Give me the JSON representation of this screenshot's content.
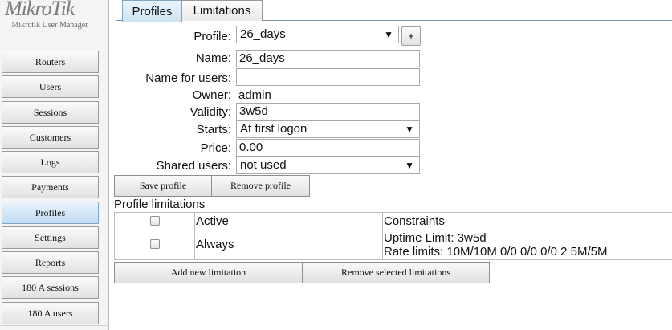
{
  "sidebar": {
    "logo": "MikroTik",
    "logo_sub": "Mikrotik User Manager",
    "items": [
      {
        "label": "Routers"
      },
      {
        "label": "Users"
      },
      {
        "label": "Sessions"
      },
      {
        "label": "Customers"
      },
      {
        "label": "Logs"
      },
      {
        "label": "Payments"
      },
      {
        "label": "Profiles",
        "active": true
      },
      {
        "label": "Settings"
      },
      {
        "label": "Reports"
      },
      {
        "label": "180 A sessions"
      },
      {
        "label": "180 A users"
      }
    ]
  },
  "tabs": [
    {
      "label": "Profiles",
      "active": true
    },
    {
      "label": "Limitations",
      "active": false
    }
  ],
  "form": {
    "profile": {
      "label": "Profile:",
      "value": "26_days"
    },
    "add_button": "+",
    "name": {
      "label": "Name:",
      "value": "26_days"
    },
    "name_for_users": {
      "label": "Name for users:",
      "value": ""
    },
    "owner": {
      "label": "Owner:",
      "value": "admin"
    },
    "validity": {
      "label": "Validity:",
      "value": "3w5d"
    },
    "starts": {
      "label": "Starts:",
      "value": "At first logon"
    },
    "price": {
      "label": "Price:",
      "value": "0.00"
    },
    "shared_users": {
      "label": "Shared users:",
      "value": "not used"
    },
    "save_label": "Save profile",
    "remove_label": "Remove profile"
  },
  "limitations": {
    "title": "Profile limitations",
    "headers": {
      "active": "Active",
      "constraints": "Constraints"
    },
    "rows": [
      {
        "active": "Always",
        "uptime": "Uptime Limit: 3w5d",
        "rate": "Rate limits: 10M/10M 0/0 0/0 0/0 2 5M/5M"
      }
    ],
    "add_label": "Add new limitation",
    "remove_label": "Remove selected limitations"
  },
  "colors": {
    "active_nav": "#c2dcf1",
    "border": "#9a9a9a"
  }
}
